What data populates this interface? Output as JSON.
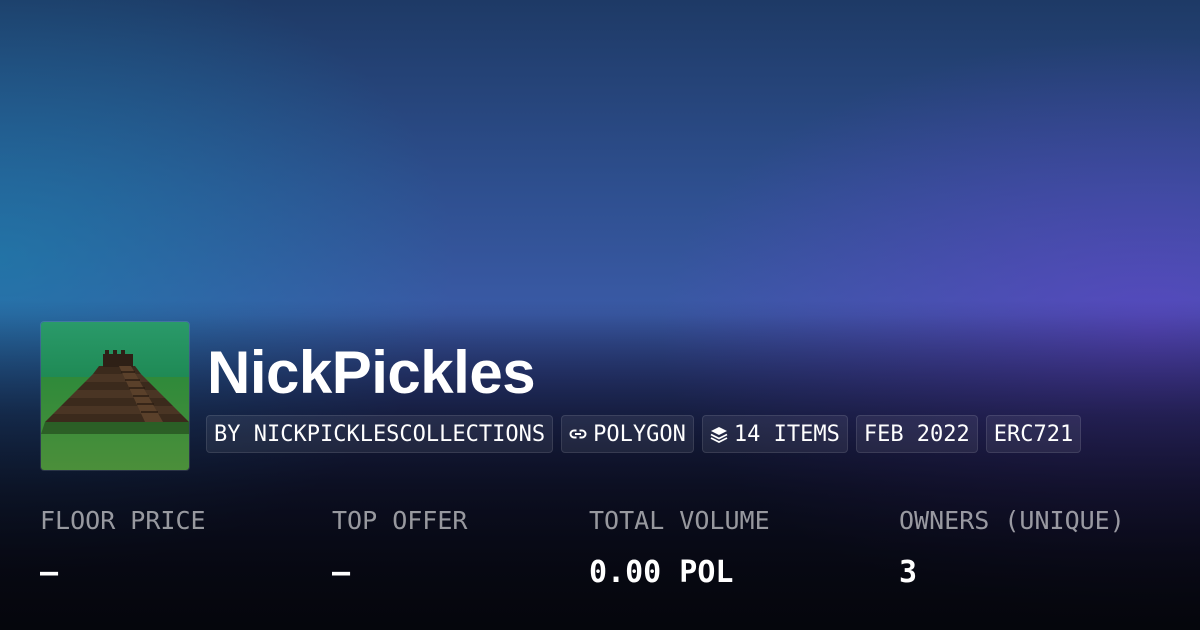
{
  "collection": {
    "name": "NickPickles",
    "avatar_alt": "stepped pyramid image",
    "badges": {
      "creator": "BY NICKPICKLESCOLLECTIONS",
      "chain": "POLYGON",
      "chain_icon": "chain-link-icon",
      "items": "14 ITEMS",
      "items_icon": "layers-icon",
      "created": "FEB 2022",
      "standard": "ERC721"
    }
  },
  "stats": [
    {
      "label": "FLOOR PRICE",
      "value": "—"
    },
    {
      "label": "TOP OFFER",
      "value": "—"
    },
    {
      "label": "TOTAL VOLUME",
      "value": "0.00 POL"
    },
    {
      "label": "OWNERS (UNIQUE)",
      "value": "3"
    }
  ],
  "colors": {
    "background_top": "#1e3a66",
    "background_mid": "#3a5aa6",
    "background_bottom": "#05060d",
    "avatar_grass": "#2f8a3a",
    "avatar_sky": "#2a9a6a"
  }
}
